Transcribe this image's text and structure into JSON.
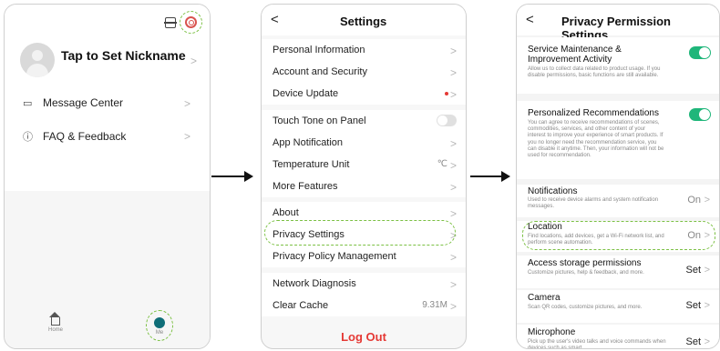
{
  "profile": {
    "nickname": "Tap to Set Nickname",
    "menu": [
      {
        "label": "Message Center",
        "icon": "message-icon"
      },
      {
        "label": "FAQ & Feedback",
        "icon": "help-icon"
      }
    ],
    "tabs": [
      {
        "label": "Home",
        "icon": "home-icon"
      },
      {
        "label": "Me",
        "icon": "person-icon"
      }
    ]
  },
  "settings": {
    "title": "Settings",
    "items": [
      {
        "label": "Personal Information"
      },
      {
        "label": "Account and Security"
      },
      {
        "label": "Device Update"
      },
      {
        "label": "Touch Tone on Panel"
      },
      {
        "label": "App Notification"
      },
      {
        "label": "Temperature Unit",
        "value": "℃"
      },
      {
        "label": "More Features"
      },
      {
        "label": "About"
      },
      {
        "label": "Privacy Settings"
      },
      {
        "label": "Privacy Policy Management"
      },
      {
        "label": "Network Diagnosis"
      },
      {
        "label": "Clear Cache",
        "value": "9.31M"
      }
    ],
    "logout": "Log Out"
  },
  "privacy": {
    "title": "Privacy Permission Settings",
    "items": [
      {
        "title": "Service Maintenance & Improvement Activity",
        "desc": "Allow us to collect data related to product usage. If you disable permissions, basic functions are still available.",
        "status": ""
      },
      {
        "title": "Personalized Recommendations",
        "desc": "You can agree to receive recommendations of scenes, commodities, services, and other content of your interest to improve your experience of smart products. If you no longer need the recommendation service, you can disable it anytime. Then, your information will not be used for recommendation.",
        "status": ""
      },
      {
        "title": "Notifications",
        "desc": "Used to receive device alarms and system notification messages.",
        "status": "On"
      },
      {
        "title": "Location",
        "desc": "Find locations, add devices, get a Wi-Fi network list, and perform scene automation.",
        "status": "On"
      },
      {
        "title": "Access storage permissions",
        "desc": "Customize pictures, help & feedback, and more.",
        "status": "Set"
      },
      {
        "title": "Camera",
        "desc": "Scan QR codes, customize pictures, and more.",
        "status": "Set"
      },
      {
        "title": "Microphone",
        "desc": "Pick up the user's video talks and voice commands when devices such as smart",
        "status": "Set"
      }
    ]
  },
  "colors": {
    "accent": "#1fb67a",
    "highlight": "#7bc043",
    "danger": "#e53935"
  }
}
